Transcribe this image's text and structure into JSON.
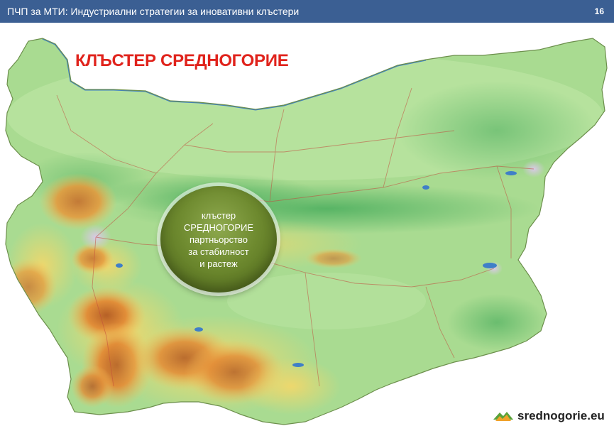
{
  "header": {
    "title": "ПЧП за МТИ: Индустриални стратегии за иновативни клъстери",
    "page_number": "16"
  },
  "slide": {
    "heading": "КЛЪСТЕР СРЕДНОГОРИЕ",
    "bubble_lines": [
      "клъстер",
      "СРЕДНОГОРИЕ",
      "партньорство",
      "за стабилност",
      "и растеж"
    ]
  },
  "logo": {
    "text": "srednogorie.eu"
  },
  "colors": {
    "header_bg": "#3b5f93",
    "heading_red": "#e0231c",
    "bubble_green": "#6e8a2f",
    "map_lowland": "#9fd68a",
    "map_mountain": "#e8973a",
    "danube_blue": "#3f7fc8"
  }
}
